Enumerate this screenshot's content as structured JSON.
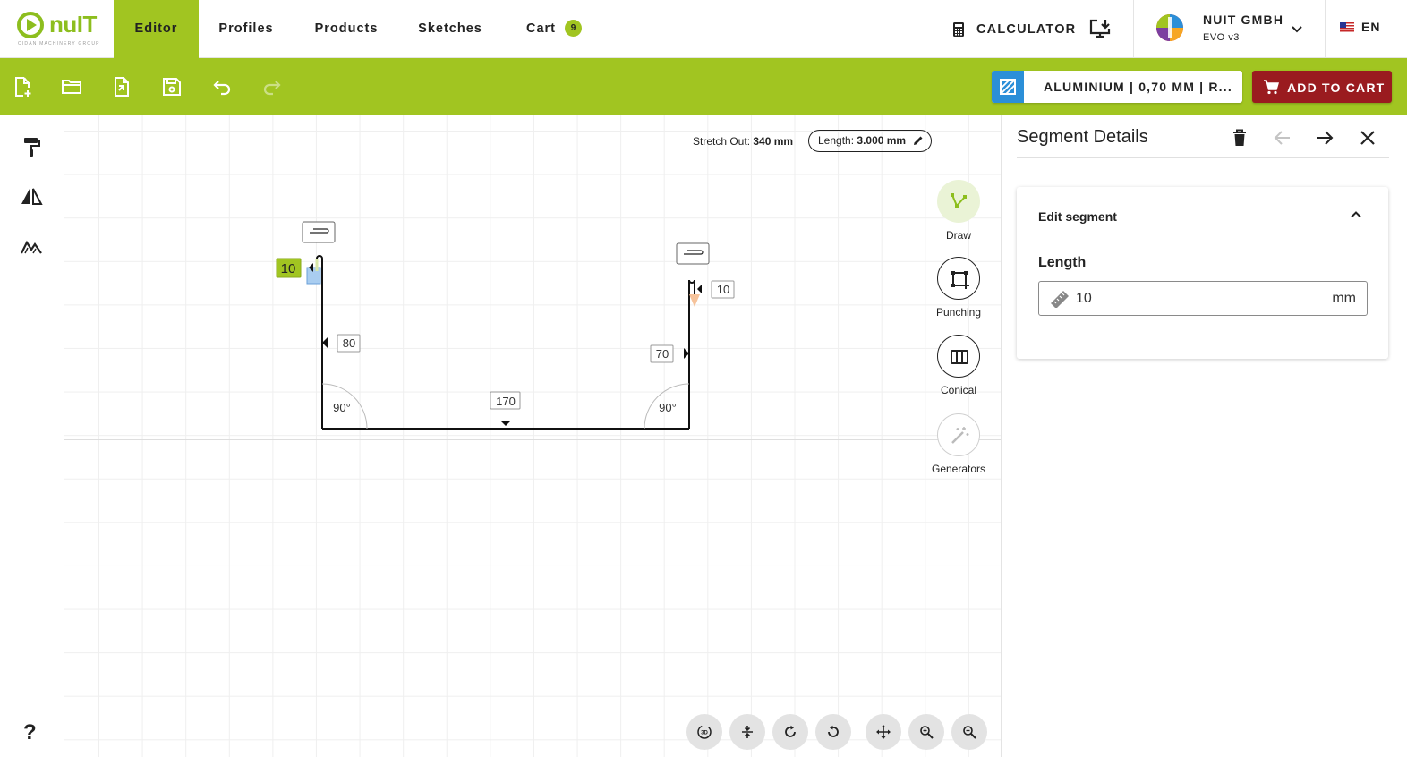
{
  "brand": {
    "logo_text": "nuIT",
    "logo_sub": "CIDAN MACHINERY GROUP"
  },
  "nav": {
    "tabs": [
      {
        "label": "Editor",
        "active": true
      },
      {
        "label": "Profiles"
      },
      {
        "label": "Products"
      },
      {
        "label": "Sketches"
      },
      {
        "label": "Cart"
      }
    ],
    "cart_count": "9",
    "calculator_label": "CALCULATOR",
    "company_name": "NUIT GMBH",
    "company_version": "EVO v3",
    "language": "EN"
  },
  "toolbar": {
    "material": "ALUMINIUM | 0,70 MM | R...",
    "add_to_cart": "ADD TO CART",
    "accent_color": "#a1c521",
    "cart_button_color": "#9a1b1f"
  },
  "canvas": {
    "stretch_out_label": "Stretch Out:",
    "stretch_out_value": "340 mm",
    "length_label": "Length:",
    "length_value": "3.000 mm",
    "segment_labels": {
      "left_hem": "10",
      "left_wall": "80",
      "bottom": "170",
      "right_wall": "70",
      "right_hem": "10"
    },
    "angles": {
      "left": "90°",
      "right": "90°"
    },
    "tools": [
      {
        "label": "Draw",
        "icon": "draw-icon"
      },
      {
        "label": "Punching",
        "icon": "punching-icon"
      },
      {
        "label": "Conical",
        "icon": "conical-icon"
      },
      {
        "label": "Generators",
        "icon": "magic-wand-icon"
      }
    ]
  },
  "panel": {
    "title": "Segment Details",
    "card_title": "Edit segment",
    "field_label": "Length",
    "field_value": "10",
    "field_unit": "mm"
  }
}
